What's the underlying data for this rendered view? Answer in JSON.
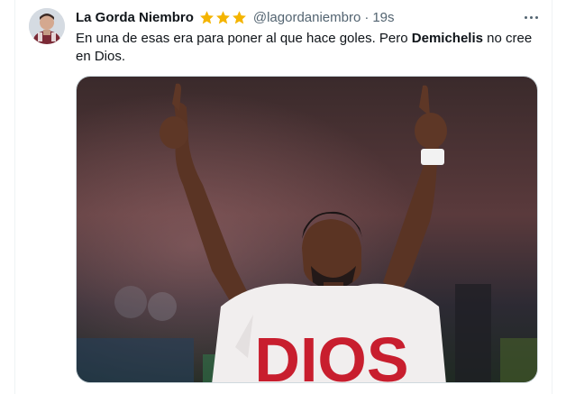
{
  "tweet": {
    "display_name": "La Gorda Niembro",
    "handle": "@lagordaniembro",
    "separator": "·",
    "time": "19s",
    "stars_count": 3,
    "star_color": "#f4b400",
    "text_before": "En una de esas era para poner al que hace goles. Pero ",
    "text_bold": "Demichelis",
    "text_after": " no cree en Dios.",
    "media_shirt_text": "DIOS",
    "icons": [
      "star-icon",
      "more-options-icon"
    ]
  }
}
